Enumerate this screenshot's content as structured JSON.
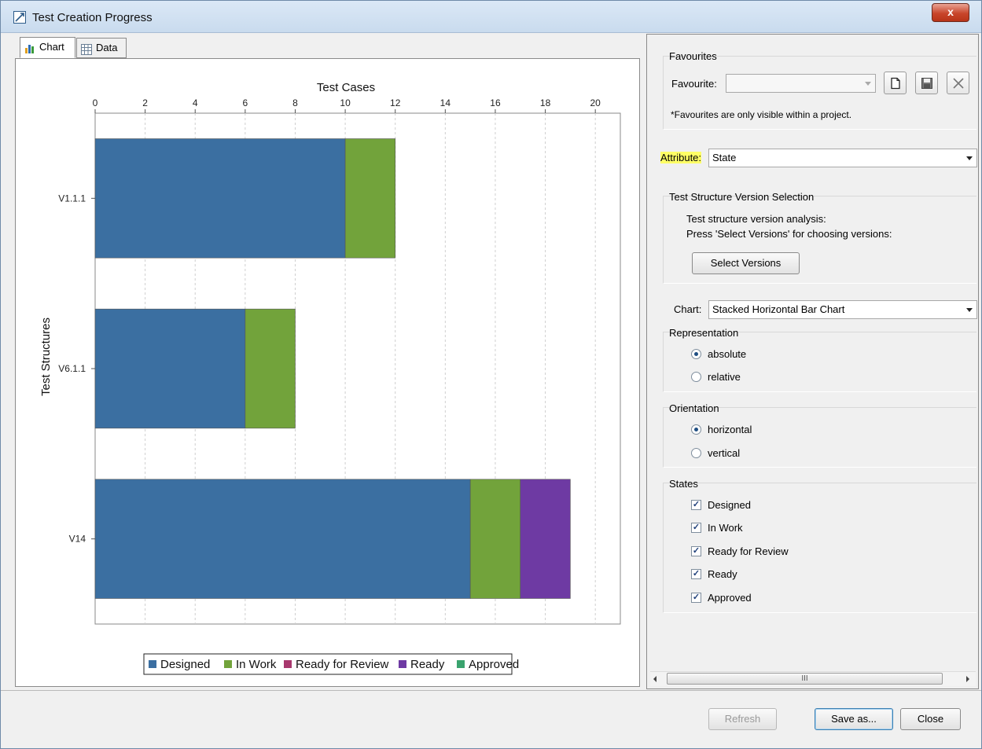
{
  "window": {
    "title": "Test Creation Progress",
    "close_glyph": "x"
  },
  "tabs": [
    {
      "label": "Chart",
      "icon": "chart-icon",
      "active": true
    },
    {
      "label": "Data",
      "icon": "table-icon",
      "active": false
    }
  ],
  "chart_data": {
    "type": "bar",
    "orientation": "horizontal",
    "stacked": true,
    "xlabel": "Test Cases",
    "ylabel": "Test Structures",
    "categories": [
      "V1.1.1",
      "V6.1.1",
      "V14"
    ],
    "xlim": [
      0,
      21
    ],
    "x_ticks": [
      0,
      2,
      4,
      6,
      8,
      10,
      12,
      14,
      16,
      18,
      20
    ],
    "grid": true,
    "legend_position": "bottom",
    "series": [
      {
        "name": "Designed",
        "color": "#3b6fa1",
        "values": [
          10,
          6,
          15
        ]
      },
      {
        "name": "In Work",
        "color": "#72a33b",
        "values": [
          2,
          2,
          2
        ]
      },
      {
        "name": "Ready for Review",
        "color": "#a8386e",
        "values": [
          0,
          0,
          0
        ]
      },
      {
        "name": "Ready",
        "color": "#6e3aa3",
        "values": [
          0,
          0,
          2
        ]
      },
      {
        "name": "Approved",
        "color": "#3aa36e",
        "values": [
          0,
          0,
          0
        ]
      }
    ]
  },
  "favourites": {
    "group_label": "Favourites",
    "field_label": "Favourite:",
    "value": "",
    "note": "*Favourites are only visible within a project.",
    "icons": [
      "new-document-icon",
      "save-icon",
      "delete-icon"
    ]
  },
  "attribute": {
    "label": "Attribute:",
    "value": "State"
  },
  "version_selection": {
    "group_label": "Test Structure Version Selection",
    "line1": "Test structure version analysis:",
    "line2": "Press 'Select Versions' for choosing versions:",
    "button": "Select Versions"
  },
  "chart_select": {
    "label": "Chart:",
    "value": "Stacked Horizontal Bar Chart"
  },
  "representation": {
    "group_label": "Representation",
    "options": [
      {
        "label": "absolute",
        "selected": true
      },
      {
        "label": "relative",
        "selected": false
      }
    ]
  },
  "orientation": {
    "group_label": "Orientation",
    "options": [
      {
        "label": "horizontal",
        "selected": true
      },
      {
        "label": "vertical",
        "selected": false
      }
    ]
  },
  "states": {
    "group_label": "States",
    "items": [
      {
        "label": "Designed",
        "checked": true
      },
      {
        "label": "In Work",
        "checked": true
      },
      {
        "label": "Ready for Review",
        "checked": true
      },
      {
        "label": "Ready",
        "checked": true
      },
      {
        "label": "Approved",
        "checked": true
      }
    ]
  },
  "scrollbar": {
    "grip": "III"
  },
  "footer": {
    "refresh": "Refresh",
    "save_as": "Save as...",
    "close": "Close"
  }
}
